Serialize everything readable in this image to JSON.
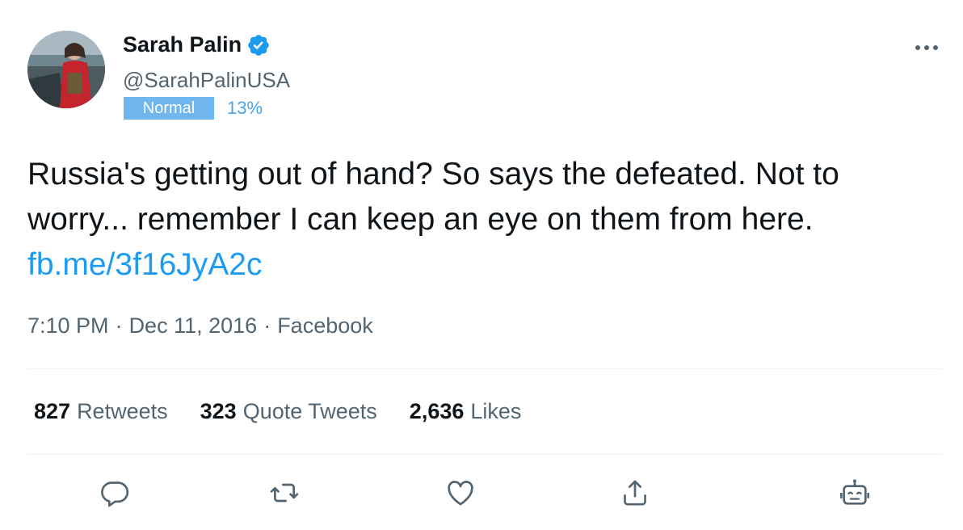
{
  "author": {
    "name": "Sarah Palin",
    "handle": "@SarahPalinUSA",
    "verified": true,
    "badge_label": "Normal",
    "badge_percent": "13%"
  },
  "tweet": {
    "text": "Russia's getting out of hand? So says the defeated. Not to worry... remember I can keep an eye on them from here.",
    "link": "fb.me/3f16JyA2c",
    "time": "7:10 PM",
    "date": "Dec 11, 2016",
    "source": "Facebook",
    "separator": "·"
  },
  "stats": {
    "retweets_count": "827",
    "retweets_label": "Retweets",
    "quotes_count": "323",
    "quotes_label": "Quote Tweets",
    "likes_count": "2,636",
    "likes_label": "Likes"
  },
  "actions": [
    "reply-icon",
    "retweet-icon",
    "like-icon",
    "share-icon",
    "bot-icon"
  ],
  "colors": {
    "link": "#1d9bf0",
    "badge": "#6fb6ee",
    "badge_percent": "#4aa3e6",
    "muted": "#536471",
    "text": "#0f1419"
  }
}
